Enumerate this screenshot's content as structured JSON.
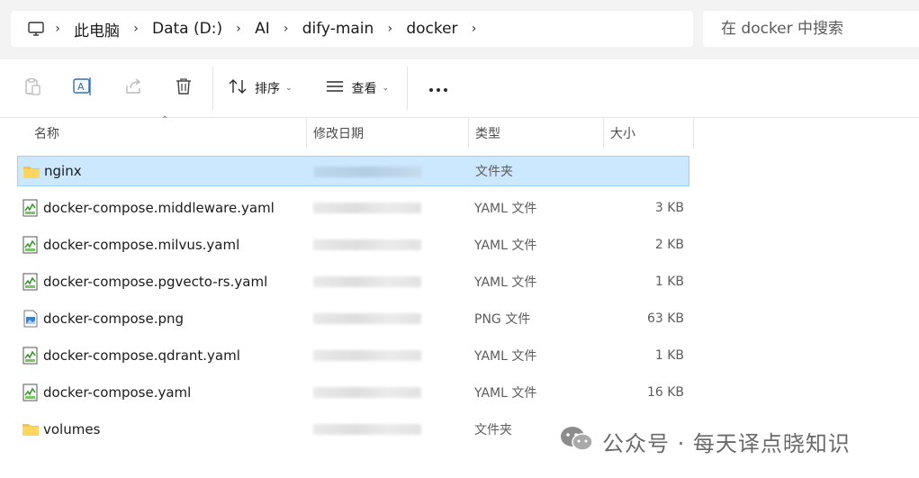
{
  "address_bar": {
    "breadcrumbs": [
      "此电脑",
      "Data (D:)",
      "AI",
      "dify-main",
      "docker"
    ]
  },
  "search": {
    "placeholder": "在 docker 中搜索"
  },
  "toolbar": {
    "sort_label": "排序",
    "view_label": "查看"
  },
  "columns": {
    "name": "名称",
    "date_modified": "修改日期",
    "type": "类型",
    "size": "大小"
  },
  "files": [
    {
      "name": "nginx",
      "type": "文件夹",
      "size": "",
      "icon": "folder-icon",
      "selected": true
    },
    {
      "name": "docker-compose.middleware.yaml",
      "type": "YAML 文件",
      "size": "3 KB",
      "icon": "yaml-file-icon",
      "selected": false
    },
    {
      "name": "docker-compose.milvus.yaml",
      "type": "YAML 文件",
      "size": "2 KB",
      "icon": "yaml-file-icon",
      "selected": false
    },
    {
      "name": "docker-compose.pgvecto-rs.yaml",
      "type": "YAML 文件",
      "size": "1 KB",
      "icon": "yaml-file-icon",
      "selected": false
    },
    {
      "name": "docker-compose.png",
      "type": "PNG 文件",
      "size": "63 KB",
      "icon": "image-file-icon",
      "selected": false
    },
    {
      "name": "docker-compose.qdrant.yaml",
      "type": "YAML 文件",
      "size": "1 KB",
      "icon": "yaml-file-icon",
      "selected": false
    },
    {
      "name": "docker-compose.yaml",
      "type": "YAML 文件",
      "size": "16 KB",
      "icon": "yaml-file-icon",
      "selected": false
    },
    {
      "name": "volumes",
      "type": "文件夹",
      "size": "",
      "icon": "folder-icon",
      "selected": false
    }
  ],
  "watermark": {
    "text": "公众号 · 每天译点晓知识"
  },
  "colors": {
    "selection_bg": "#cce8ff",
    "selection_border": "#99d1ff",
    "folder": "#f8c53a",
    "chrome_bg": "#f3f3f3"
  }
}
